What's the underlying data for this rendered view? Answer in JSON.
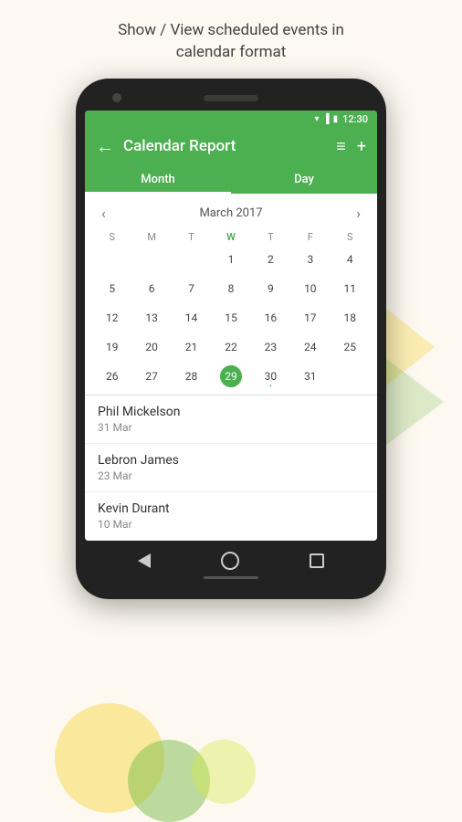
{
  "page": {
    "header": "Show / View scheduled events in\ncalendar format"
  },
  "status_bar": {
    "time": "12:30"
  },
  "app_bar": {
    "title": "Calendar Report",
    "back_label": "←",
    "list_icon": "≡",
    "add_icon": "+"
  },
  "tabs": [
    {
      "label": "Month",
      "active": true
    },
    {
      "label": "Day",
      "active": false
    }
  ],
  "calendar": {
    "nav_prev": "‹",
    "nav_next": "›",
    "month_title": "March 2017",
    "day_headers": [
      "S",
      "M",
      "T",
      "W",
      "T",
      "F",
      "S"
    ],
    "today_col_index": 3,
    "selected_day": 29,
    "weeks": [
      [
        null,
        null,
        null,
        1,
        2,
        3,
        4
      ],
      [
        5,
        6,
        7,
        8,
        9,
        10,
        11
      ],
      [
        12,
        13,
        14,
        15,
        16,
        17,
        18
      ],
      [
        19,
        20,
        21,
        22,
        23,
        24,
        25
      ],
      [
        26,
        27,
        28,
        29,
        30,
        31,
        null
      ]
    ],
    "event_days": [
      30
    ]
  },
  "events": [
    {
      "name": "Phil Mickelson",
      "date": "31 Mar"
    },
    {
      "name": "Lebron James",
      "date": "23 Mar"
    },
    {
      "name": "Kevin Durant",
      "date": "10 Mar"
    }
  ]
}
